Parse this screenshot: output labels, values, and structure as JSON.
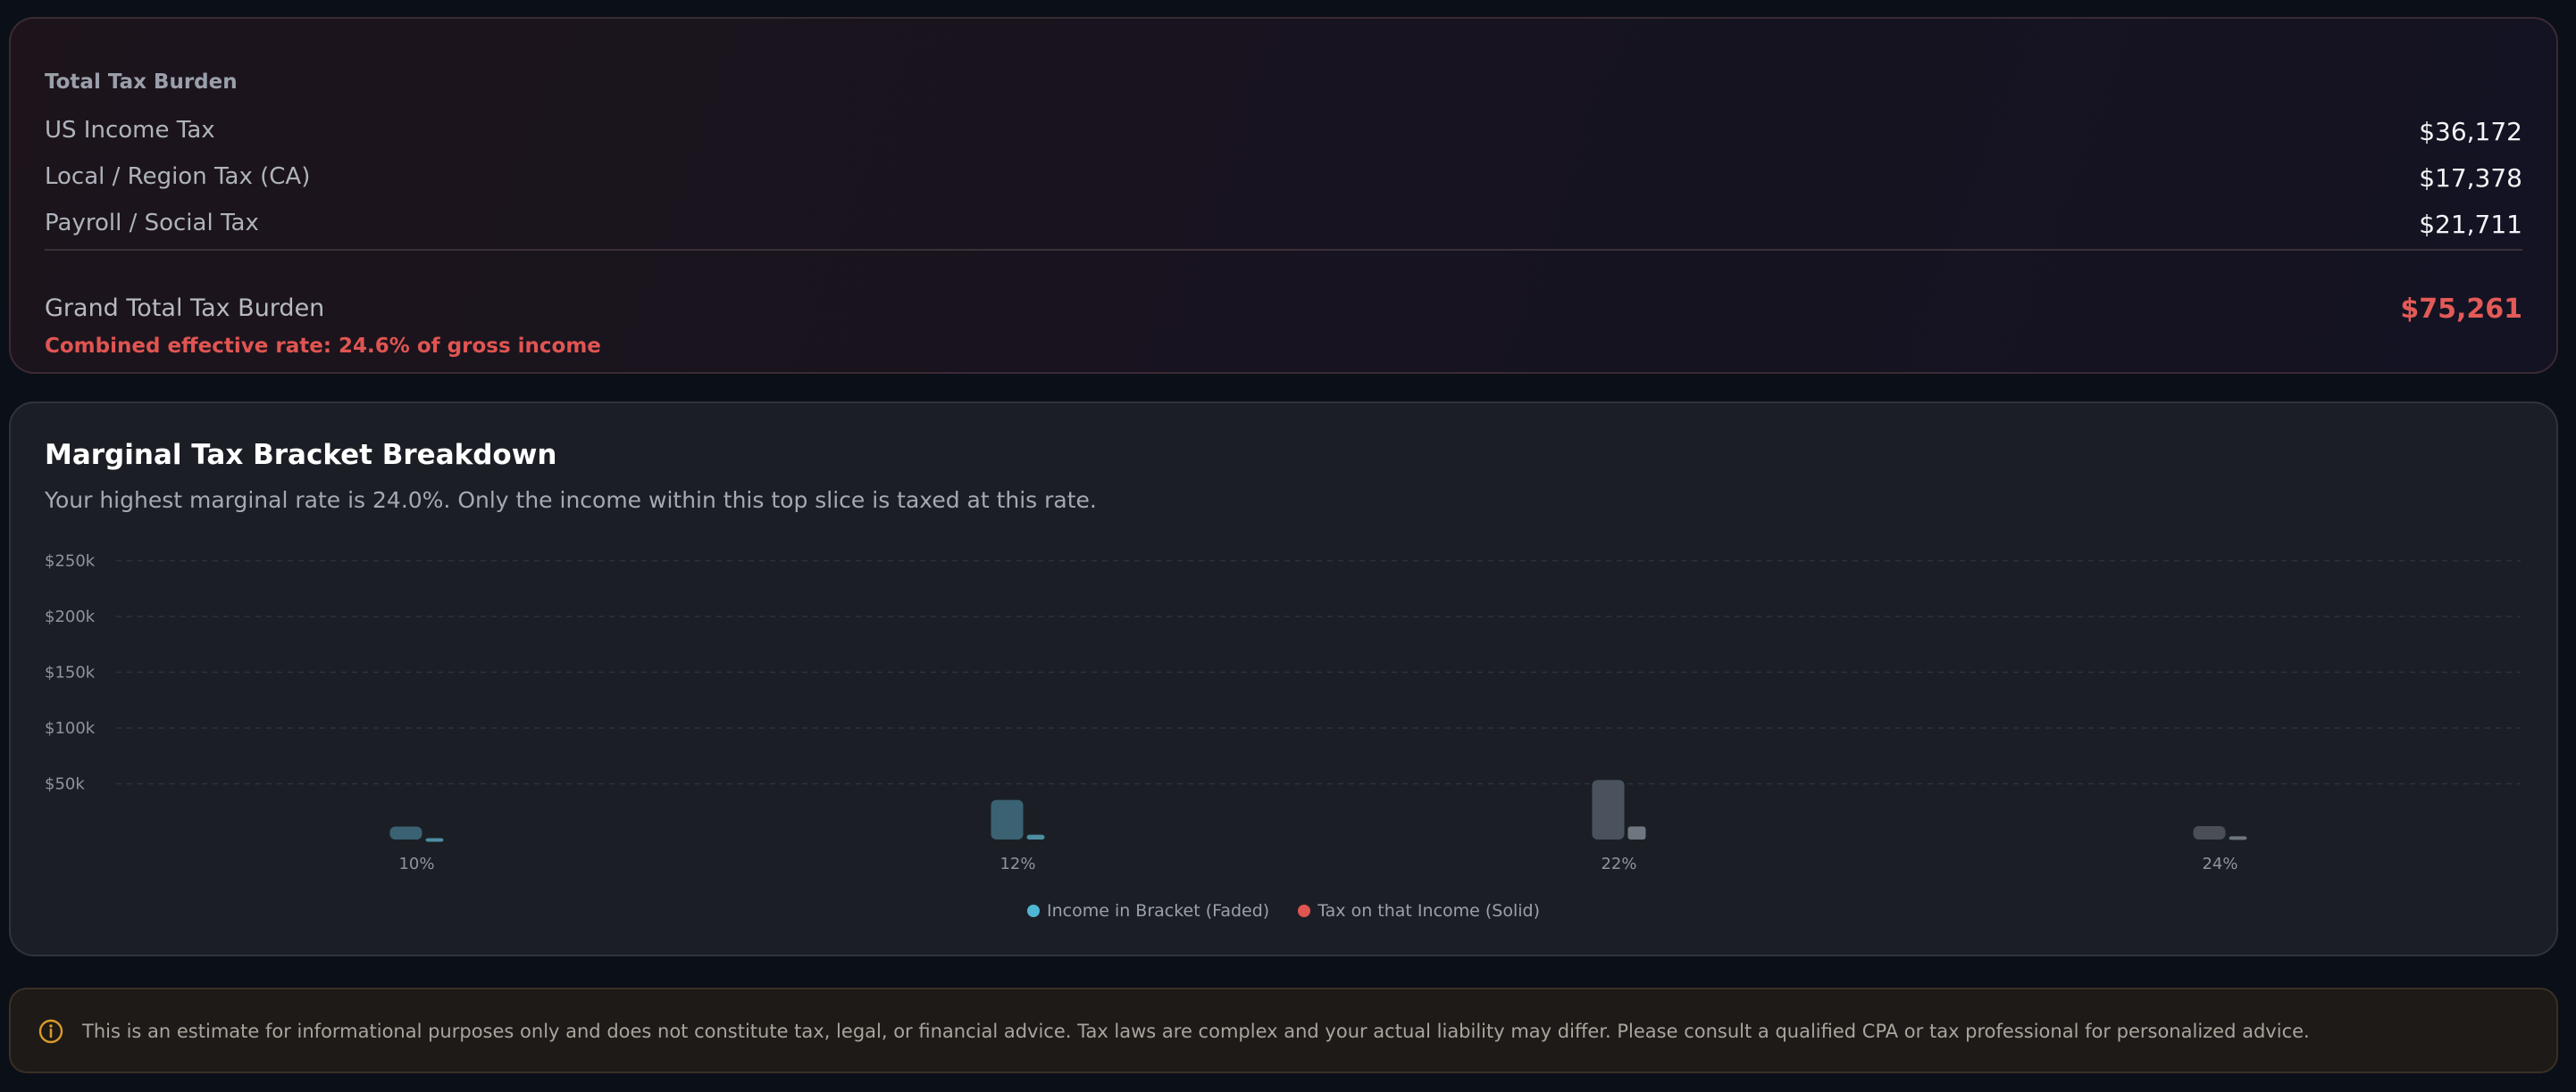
{
  "summary": {
    "title": "Total Tax Burden",
    "rows": [
      {
        "label": "US Income Tax",
        "value": "$36,172"
      },
      {
        "label": "Local / Region Tax (CA)",
        "value": "$17,378"
      },
      {
        "label": "Payroll / Social Tax",
        "value": "$21,711"
      }
    ],
    "grand_label": "Grand Total Tax Burden",
    "grand_value": "$75,261",
    "grand_note": "Combined effective rate: 24.6% of gross income",
    "accent_color": "#e35a57"
  },
  "bracket": {
    "title": "Marginal Tax Bracket Breakdown",
    "subtitle": "Your highest marginal rate is 24.0%. Only the income within this top slice is taxed at this rate."
  },
  "chart_data": {
    "type": "bar",
    "categories": [
      "10%",
      "12%",
      "22%",
      "24%"
    ],
    "series": [
      {
        "name": "Income in Bracket (Faded)",
        "values": [
          11600,
          35550,
          53375,
          12000
        ],
        "color": "#4fb7d4"
      },
      {
        "name": "Tax on that Income (Solid)",
        "values": [
          1160,
          4266,
          11742,
          2880
        ],
        "color": "#e05552"
      }
    ],
    "y_ticks": [
      "$50k",
      "$100k",
      "$150k",
      "$200k",
      "$250k"
    ],
    "ylim": [
      0,
      250000
    ],
    "grid": true,
    "legend_position": "bottom-center",
    "bar_fills": {
      "income": [
        "#3a6272",
        "#3a6272",
        "#4a535d",
        "#4a4f57"
      ],
      "tax": [
        "#4d8ea3",
        "#4d8ea3",
        "#6e7680",
        "#6e7680"
      ]
    }
  },
  "disclaimer": {
    "icon": "info-circle-icon",
    "text": "This is an estimate for informational purposes only and does not constitute tax, legal, or financial advice. Tax laws are complex and your actual liability may differ. Please consult a qualified CPA or tax professional for personalized advice.",
    "icon_color": "#d99a2b"
  }
}
